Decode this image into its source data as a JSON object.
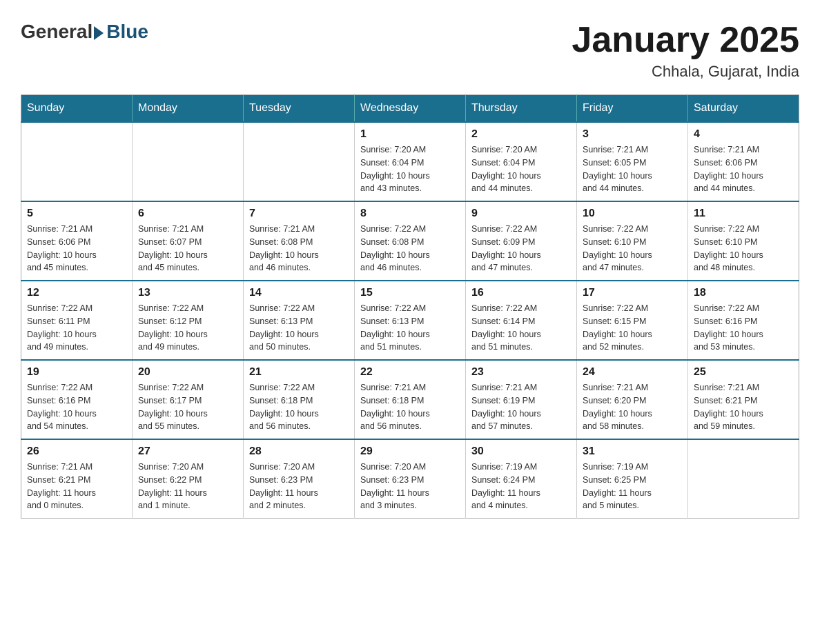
{
  "logo": {
    "general": "General",
    "blue": "Blue"
  },
  "title": "January 2025",
  "subtitle": "Chhala, Gujarat, India",
  "days_header": [
    "Sunday",
    "Monday",
    "Tuesday",
    "Wednesday",
    "Thursday",
    "Friday",
    "Saturday"
  ],
  "weeks": [
    [
      {
        "day": "",
        "info": ""
      },
      {
        "day": "",
        "info": ""
      },
      {
        "day": "",
        "info": ""
      },
      {
        "day": "1",
        "info": "Sunrise: 7:20 AM\nSunset: 6:04 PM\nDaylight: 10 hours\nand 43 minutes."
      },
      {
        "day": "2",
        "info": "Sunrise: 7:20 AM\nSunset: 6:04 PM\nDaylight: 10 hours\nand 44 minutes."
      },
      {
        "day": "3",
        "info": "Sunrise: 7:21 AM\nSunset: 6:05 PM\nDaylight: 10 hours\nand 44 minutes."
      },
      {
        "day": "4",
        "info": "Sunrise: 7:21 AM\nSunset: 6:06 PM\nDaylight: 10 hours\nand 44 minutes."
      }
    ],
    [
      {
        "day": "5",
        "info": "Sunrise: 7:21 AM\nSunset: 6:06 PM\nDaylight: 10 hours\nand 45 minutes."
      },
      {
        "day": "6",
        "info": "Sunrise: 7:21 AM\nSunset: 6:07 PM\nDaylight: 10 hours\nand 45 minutes."
      },
      {
        "day": "7",
        "info": "Sunrise: 7:21 AM\nSunset: 6:08 PM\nDaylight: 10 hours\nand 46 minutes."
      },
      {
        "day": "8",
        "info": "Sunrise: 7:22 AM\nSunset: 6:08 PM\nDaylight: 10 hours\nand 46 minutes."
      },
      {
        "day": "9",
        "info": "Sunrise: 7:22 AM\nSunset: 6:09 PM\nDaylight: 10 hours\nand 47 minutes."
      },
      {
        "day": "10",
        "info": "Sunrise: 7:22 AM\nSunset: 6:10 PM\nDaylight: 10 hours\nand 47 minutes."
      },
      {
        "day": "11",
        "info": "Sunrise: 7:22 AM\nSunset: 6:10 PM\nDaylight: 10 hours\nand 48 minutes."
      }
    ],
    [
      {
        "day": "12",
        "info": "Sunrise: 7:22 AM\nSunset: 6:11 PM\nDaylight: 10 hours\nand 49 minutes."
      },
      {
        "day": "13",
        "info": "Sunrise: 7:22 AM\nSunset: 6:12 PM\nDaylight: 10 hours\nand 49 minutes."
      },
      {
        "day": "14",
        "info": "Sunrise: 7:22 AM\nSunset: 6:13 PM\nDaylight: 10 hours\nand 50 minutes."
      },
      {
        "day": "15",
        "info": "Sunrise: 7:22 AM\nSunset: 6:13 PM\nDaylight: 10 hours\nand 51 minutes."
      },
      {
        "day": "16",
        "info": "Sunrise: 7:22 AM\nSunset: 6:14 PM\nDaylight: 10 hours\nand 51 minutes."
      },
      {
        "day": "17",
        "info": "Sunrise: 7:22 AM\nSunset: 6:15 PM\nDaylight: 10 hours\nand 52 minutes."
      },
      {
        "day": "18",
        "info": "Sunrise: 7:22 AM\nSunset: 6:16 PM\nDaylight: 10 hours\nand 53 minutes."
      }
    ],
    [
      {
        "day": "19",
        "info": "Sunrise: 7:22 AM\nSunset: 6:16 PM\nDaylight: 10 hours\nand 54 minutes."
      },
      {
        "day": "20",
        "info": "Sunrise: 7:22 AM\nSunset: 6:17 PM\nDaylight: 10 hours\nand 55 minutes."
      },
      {
        "day": "21",
        "info": "Sunrise: 7:22 AM\nSunset: 6:18 PM\nDaylight: 10 hours\nand 56 minutes."
      },
      {
        "day": "22",
        "info": "Sunrise: 7:21 AM\nSunset: 6:18 PM\nDaylight: 10 hours\nand 56 minutes."
      },
      {
        "day": "23",
        "info": "Sunrise: 7:21 AM\nSunset: 6:19 PM\nDaylight: 10 hours\nand 57 minutes."
      },
      {
        "day": "24",
        "info": "Sunrise: 7:21 AM\nSunset: 6:20 PM\nDaylight: 10 hours\nand 58 minutes."
      },
      {
        "day": "25",
        "info": "Sunrise: 7:21 AM\nSunset: 6:21 PM\nDaylight: 10 hours\nand 59 minutes."
      }
    ],
    [
      {
        "day": "26",
        "info": "Sunrise: 7:21 AM\nSunset: 6:21 PM\nDaylight: 11 hours\nand 0 minutes."
      },
      {
        "day": "27",
        "info": "Sunrise: 7:20 AM\nSunset: 6:22 PM\nDaylight: 11 hours\nand 1 minute."
      },
      {
        "day": "28",
        "info": "Sunrise: 7:20 AM\nSunset: 6:23 PM\nDaylight: 11 hours\nand 2 minutes."
      },
      {
        "day": "29",
        "info": "Sunrise: 7:20 AM\nSunset: 6:23 PM\nDaylight: 11 hours\nand 3 minutes."
      },
      {
        "day": "30",
        "info": "Sunrise: 7:19 AM\nSunset: 6:24 PM\nDaylight: 11 hours\nand 4 minutes."
      },
      {
        "day": "31",
        "info": "Sunrise: 7:19 AM\nSunset: 6:25 PM\nDaylight: 11 hours\nand 5 minutes."
      },
      {
        "day": "",
        "info": ""
      }
    ]
  ]
}
